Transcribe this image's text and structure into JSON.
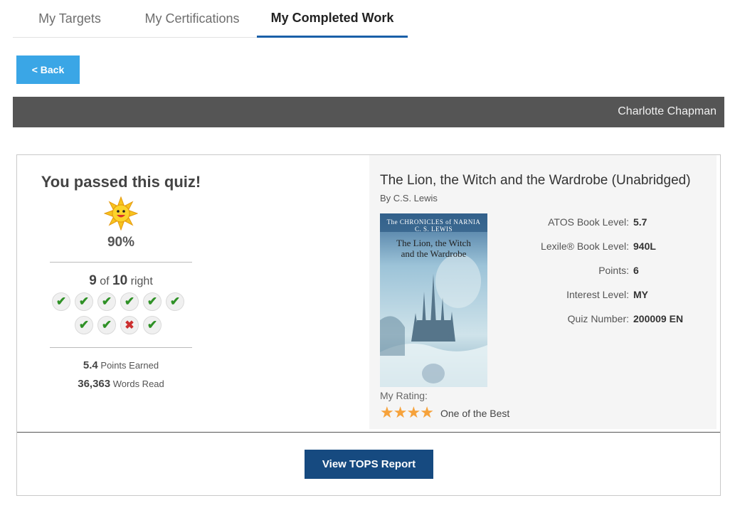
{
  "tabs": [
    {
      "label": "My Targets"
    },
    {
      "label": "My Certifications"
    },
    {
      "label": "My Completed Work"
    }
  ],
  "back_label": "< Back",
  "student_name": "Charlotte Chapman",
  "quiz": {
    "passed_text": "You passed this quiz!",
    "percent": "90%",
    "correct": "9",
    "of_text": "of",
    "total": "10",
    "right_text": "right",
    "answers": [
      "correct",
      "correct",
      "correct",
      "correct",
      "correct",
      "correct",
      "correct",
      "correct",
      "incorrect",
      "correct"
    ],
    "points_value": "5.4",
    "points_label": "Points Earned",
    "words_value": "36,363",
    "words_label": "Words Read"
  },
  "book": {
    "title": "The Lion, the Witch and the Wardrobe (Unabridged)",
    "author": "By C.S. Lewis",
    "cover_series": "The CHRONICLES of NARNIA",
    "cover_author": "C. S. LEWIS",
    "cover_title_line1": "The Lion, the Witch",
    "cover_title_line2": "and the Wardrobe",
    "meta": [
      {
        "label": "ATOS Book Level:",
        "value": "5.7"
      },
      {
        "label": "Lexile® Book Level:",
        "value": "940L"
      },
      {
        "label": "Points:",
        "value": "6"
      },
      {
        "label": "Interest Level:",
        "value": "MY"
      },
      {
        "label": "Quiz Number:",
        "value": "200009 EN"
      }
    ],
    "rating_label": "My Rating:",
    "rating_stars": 4,
    "rating_text": "One of the Best"
  },
  "tops_button": "View TOPS Report",
  "colors": {
    "back_button": "#3aa6e6",
    "name_bar": "#555555",
    "tab_active_underline": "#1a5fa8",
    "tops_button": "#164a80",
    "star": "#f6a23b",
    "check": "#2f9126",
    "cross": "#cc2f2f"
  }
}
